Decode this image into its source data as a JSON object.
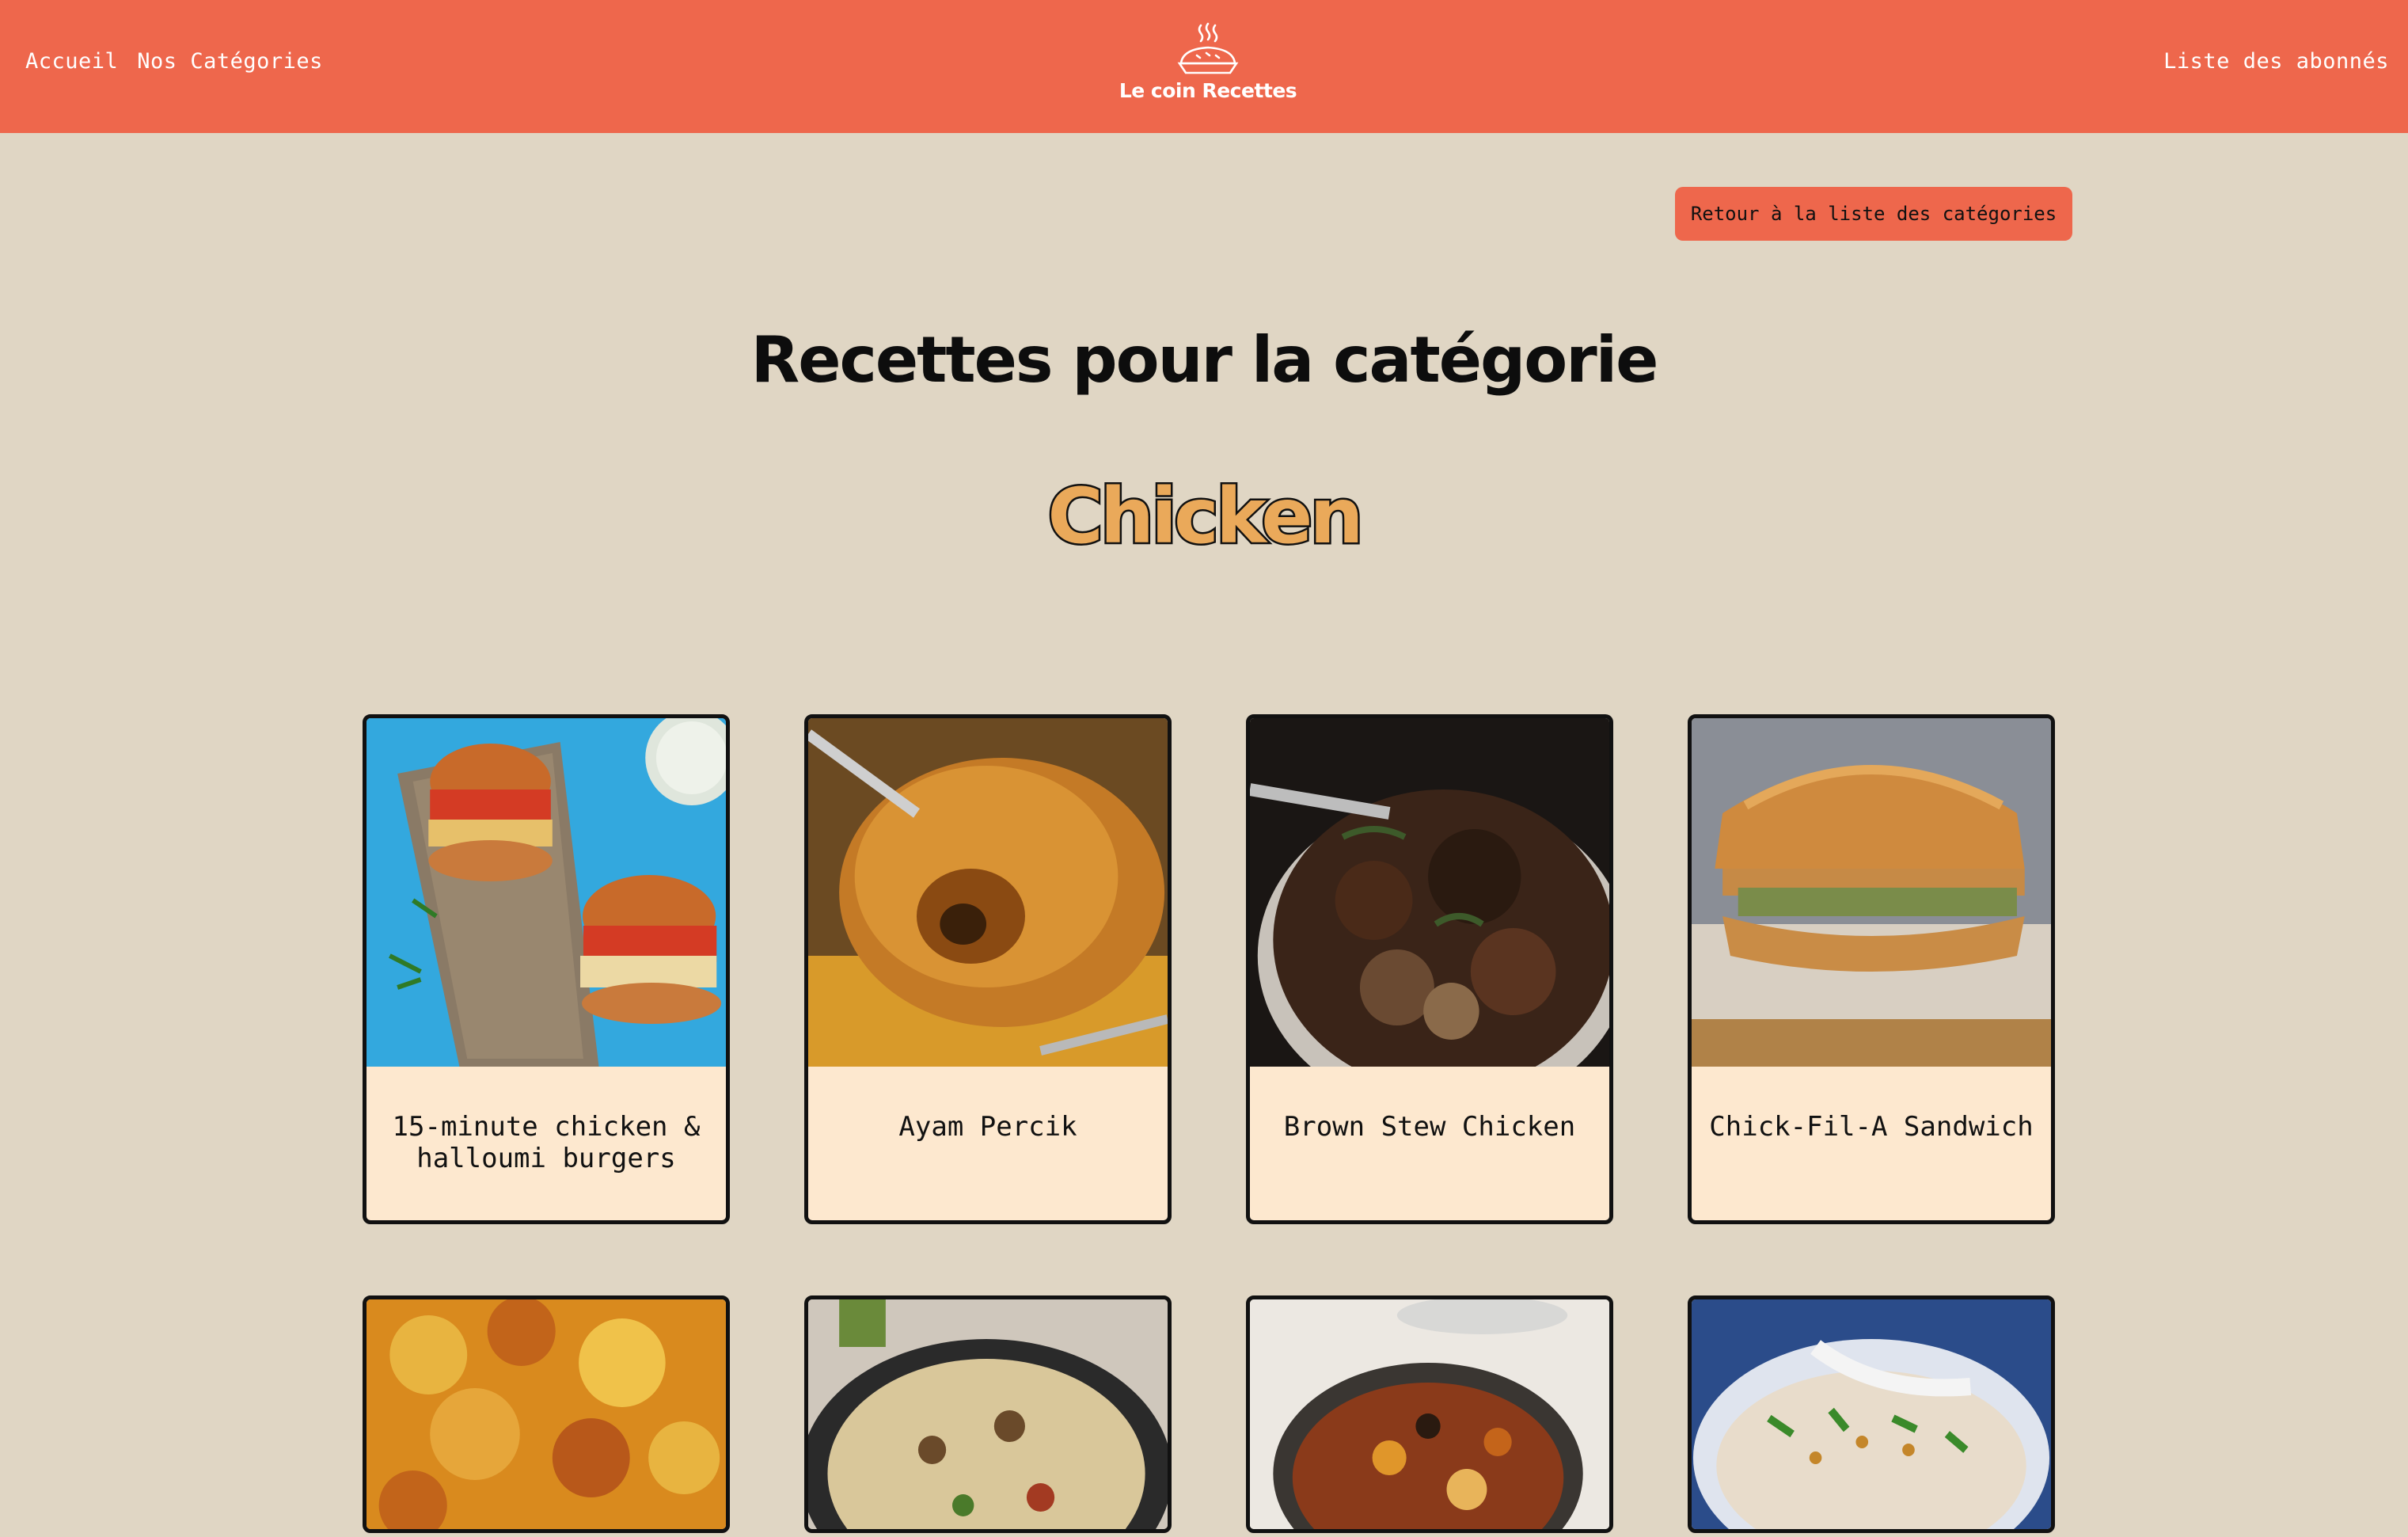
{
  "header": {
    "nav_home": "Accueil",
    "nav_categories": "Nos Catégories",
    "nav_subscribers": "Liste des abonnés",
    "logo_text": "Le coin Recettes",
    "logo_icon": "pie-icon",
    "background_color": "#ee674c"
  },
  "back_button": {
    "label": "Retour à la liste des catégories"
  },
  "page": {
    "title": "Recettes pour la catégorie",
    "category": "Chicken",
    "background_color": "#e0d6c4",
    "category_color": "#eaa95a"
  },
  "recipes": [
    {
      "title": "15-minute chicken & halloumi burgers",
      "image": "chicken-halloumi-burgers-photo"
    },
    {
      "title": "Ayam Percik",
      "image": "ayam-percik-photo"
    },
    {
      "title": "Brown Stew Chicken",
      "image": "brown-stew-chicken-photo"
    },
    {
      "title": "Chick-Fil-A Sandwich",
      "image": "chick-fil-a-sandwich-photo"
    },
    {
      "title": "",
      "image": "gratin-photo"
    },
    {
      "title": "",
      "image": "pasta-pan-photo"
    },
    {
      "title": "",
      "image": "casserole-photo"
    },
    {
      "title": "",
      "image": "congee-bowl-photo"
    }
  ]
}
